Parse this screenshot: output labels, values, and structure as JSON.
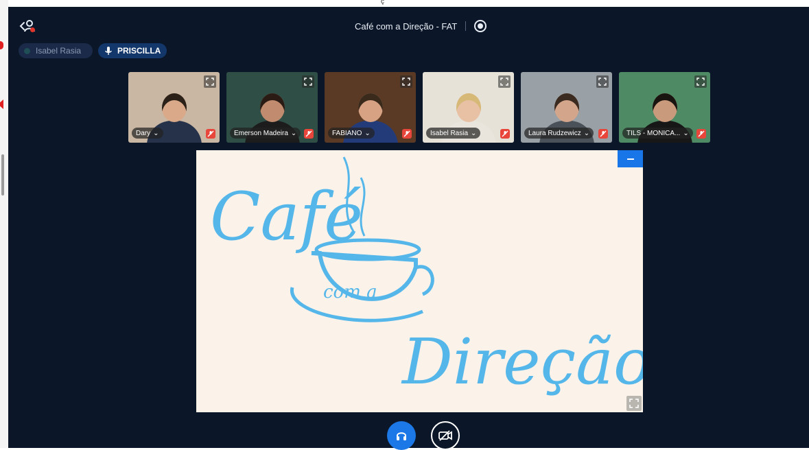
{
  "meeting": {
    "title": "Café com a Direção - FAT"
  },
  "top_char": "ç",
  "pills": {
    "isabel": "Isabel Rasia",
    "priscilla": "PRISCILLA"
  },
  "participants": [
    {
      "name": "Dary",
      "bg": "#c9b7a3",
      "shirt": "#26324a",
      "skin": "#d9a98a",
      "hair": "#2b2118"
    },
    {
      "name": "Emerson Madeira",
      "bg": "#2f4e45",
      "shirt": "#1c1c1c",
      "skin": "#c08b6e",
      "hair": "#2a1c14"
    },
    {
      "name": "FABIANO",
      "bg": "#5a3a24",
      "shirt": "#243b7a",
      "skin": "#d7a283",
      "hair": "#3a2a1c"
    },
    {
      "name": "Isabel Rasia",
      "bg": "#e7e2d8",
      "shirt": "#e9e4dc",
      "skin": "#e8c0a4",
      "hair": "#d6b877"
    },
    {
      "name": "Laura Rudzewicz",
      "bg": "#9aa1a6",
      "shirt": "#4a5158",
      "skin": "#d3a68c",
      "hair": "#3a2a20"
    },
    {
      "name": "TILS - MONICA...",
      "bg": "#4e8a63",
      "shirt": "#171717",
      "skin": "#c99a7c",
      "hair": "#1a1410"
    }
  ],
  "slide": {
    "title_line1": "Café",
    "cup_text": "com a",
    "title_line2": "Direção"
  },
  "colors": {
    "background": "#0b1729",
    "accent": "#1c78e6",
    "logo": "#55b6ea",
    "mute": "#e8463a"
  },
  "icons": {
    "user": "user-icon",
    "record": "record-icon",
    "mic": "mic-icon",
    "expand": "expand-icon",
    "mute": "muted-mic-icon",
    "minimize": "minimize-icon",
    "headphones": "headphones-icon",
    "camera_off": "camera-off-icon"
  }
}
